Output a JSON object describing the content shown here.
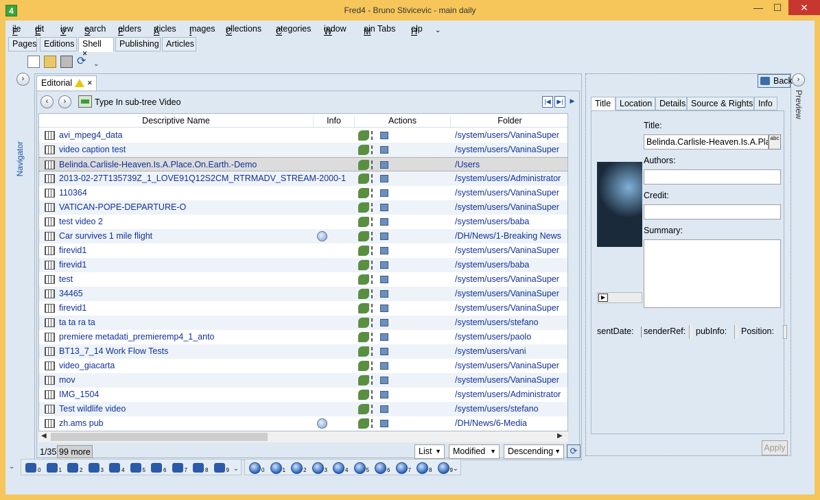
{
  "window": {
    "title": "Fred4 - Bruno Stivicevic - main daily",
    "app_icon_label": "4"
  },
  "menu": [
    "File",
    "Edit",
    "View",
    "Search",
    "Folders",
    "Articles",
    "Images",
    "Collections",
    "Categories",
    "Window",
    "Main Tabs",
    "Help"
  ],
  "main_tabs": [
    "Pages",
    "Editions",
    "Shell",
    "Publishing",
    "Articles"
  ],
  "active_main_tab": "Shell",
  "navigator_label": "Navigator",
  "editorial_tab": {
    "label": "Editorial",
    "close": "×"
  },
  "type_filter": "Type In sub-tree Video",
  "columns": [
    "Descriptive Name",
    "Info",
    "Actions",
    "Folder"
  ],
  "rows": [
    {
      "name": "avi_mpeg4_data",
      "folder": "/system/users/VaninaSuper",
      "info": false
    },
    {
      "name": "video caption test",
      "folder": "/system/users/VaninaSuper",
      "info": false
    },
    {
      "name": "Belinda.Carlisle-Heaven.Is.A.Place.On.Earth.-Demo",
      "folder": "/Users",
      "info": false
    },
    {
      "name": "2013-02-27T135739Z_1_LOVE91Q12S2CM_RTRMADV_STREAM-2000-1",
      "folder": "/system/users/Administrator",
      "info": false
    },
    {
      "name": "110364",
      "folder": "/system/users/VaninaSuper",
      "info": false
    },
    {
      "name": "VATICAN-POPE-DEPARTURE-O",
      "folder": "/system/users/VaninaSuper",
      "info": false
    },
    {
      "name": "test video 2",
      "folder": "/system/users/baba",
      "info": false
    },
    {
      "name": "Car survives 1 mile flight",
      "folder": "/DH/News/1-Breaking News",
      "info": true
    },
    {
      "name": "firevid1",
      "folder": "/system/users/VaninaSuper",
      "info": false
    },
    {
      "name": "firevid1",
      "folder": "/system/users/baba",
      "info": false
    },
    {
      "name": "test",
      "folder": "/system/users/VaninaSuper",
      "info": false
    },
    {
      "name": "34465",
      "folder": "/system/users/VaninaSuper",
      "info": false
    },
    {
      "name": "firevid1",
      "folder": "/system/users/VaninaSuper",
      "info": false
    },
    {
      "name": "ta ta ra ta",
      "folder": "/system/users/stefano",
      "info": false
    },
    {
      "name": "premiere metadati_premieremp4_1_anto",
      "folder": "/system/users/paolo",
      "info": false
    },
    {
      "name": "BT13_7_14 Work Flow Tests",
      "folder": "/system/users/vani",
      "info": false
    },
    {
      "name": "video_giacarta",
      "folder": "/system/users/VaninaSuper",
      "info": false
    },
    {
      "name": "mov",
      "folder": "/system/users/VaninaSuper",
      "info": false
    },
    {
      "name": "IMG_1504",
      "folder": "/system/users/Administrator",
      "info": false
    },
    {
      "name": "Test wildlife video",
      "folder": "/system/users/stefano",
      "info": false
    },
    {
      "name": "zh.ams pub",
      "folder": "/DH/News/6-Media",
      "info": true
    }
  ],
  "selected_row": 2,
  "footer": {
    "count": "1/35",
    "more": "99 more",
    "view": "List",
    "sort_field": "Modified",
    "sort_order": "Descending"
  },
  "detail": {
    "back_label": "Back",
    "preview_label": "Preview",
    "tabs": [
      "Title",
      "Location",
      "Details",
      "Source & Rights",
      "Info"
    ],
    "active_tab": "Title",
    "title_label": "Title:",
    "title_value": "Belinda.Carlisle-Heaven.Is.A.Place",
    "spell_label": "abc",
    "authors_label": "Authors:",
    "authors_value": "",
    "credit_label": "Credit:",
    "credit_value": "",
    "summary_label": "Summary:",
    "summary_value": "",
    "meta": [
      "sentDate:",
      "senderRef:",
      "pubInfo:",
      "Position:"
    ],
    "apply_label": "Apply"
  },
  "dock": {
    "search_slots": [
      "0",
      "1",
      "2",
      "3",
      "4",
      "5",
      "6",
      "7",
      "8",
      "9"
    ],
    "globe_slots": [
      "0",
      "1",
      "2",
      "3",
      "4",
      "5",
      "6",
      "7",
      "8",
      "9"
    ]
  },
  "colors": {
    "frame": "#f6c65a",
    "client": "#dde8f2",
    "link": "#10309a",
    "close": "#c7372f"
  }
}
